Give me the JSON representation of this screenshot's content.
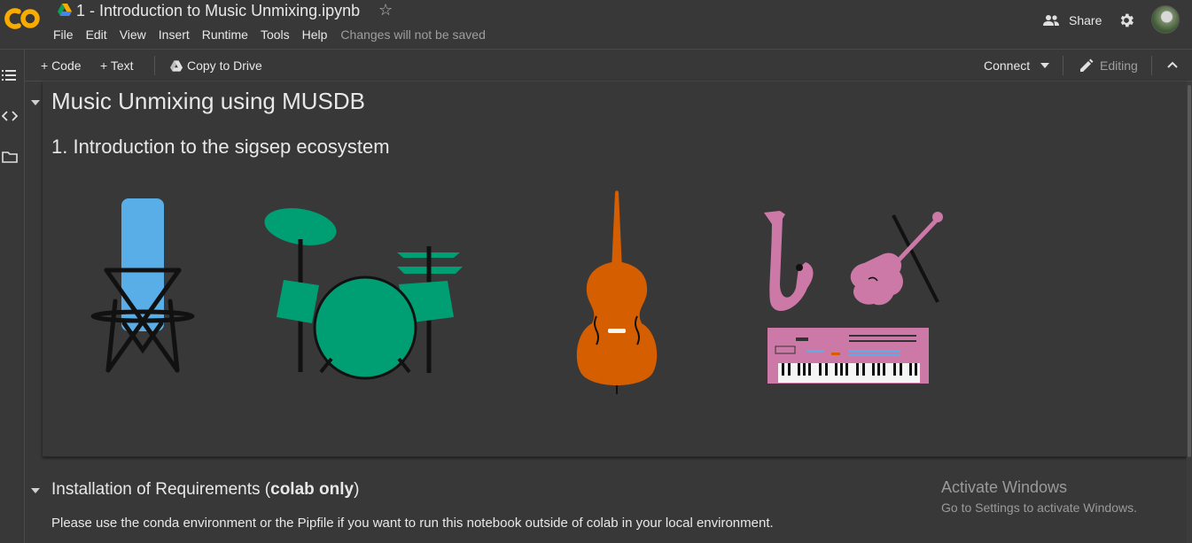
{
  "header": {
    "title": "1 - Introduction to Music Unmixing.ipynb",
    "menus": [
      "File",
      "Edit",
      "View",
      "Insert",
      "Runtime",
      "Tools",
      "Help"
    ],
    "save_status": "Changes will not be saved",
    "share_label": "Share"
  },
  "toolbar": {
    "add_code": "+ Code",
    "add_text": "+ Text",
    "copy_to_drive": "Copy to Drive",
    "connect": "Connect",
    "editing": "Editing"
  },
  "cells": {
    "heading1": "Music Unmixing using MUSDB",
    "heading2": "1. Introduction to the sigsep ecosystem",
    "install_heading_prefix": "Installation of Requirements (",
    "install_heading_bold": "colab only",
    "install_heading_suffix": ")",
    "install_text": "Please use the conda environment or the Pipfile if you want to run this notebook outside of colab in your local environment."
  },
  "watermark": {
    "line1": "Activate Windows",
    "line2": "Go to Settings to activate Windows."
  },
  "colors": {
    "vocals": "#5aaee8",
    "drums": "#009e73",
    "bass": "#d55e00",
    "other": "#cc79a7",
    "colab_orange": "#f9ab00"
  }
}
